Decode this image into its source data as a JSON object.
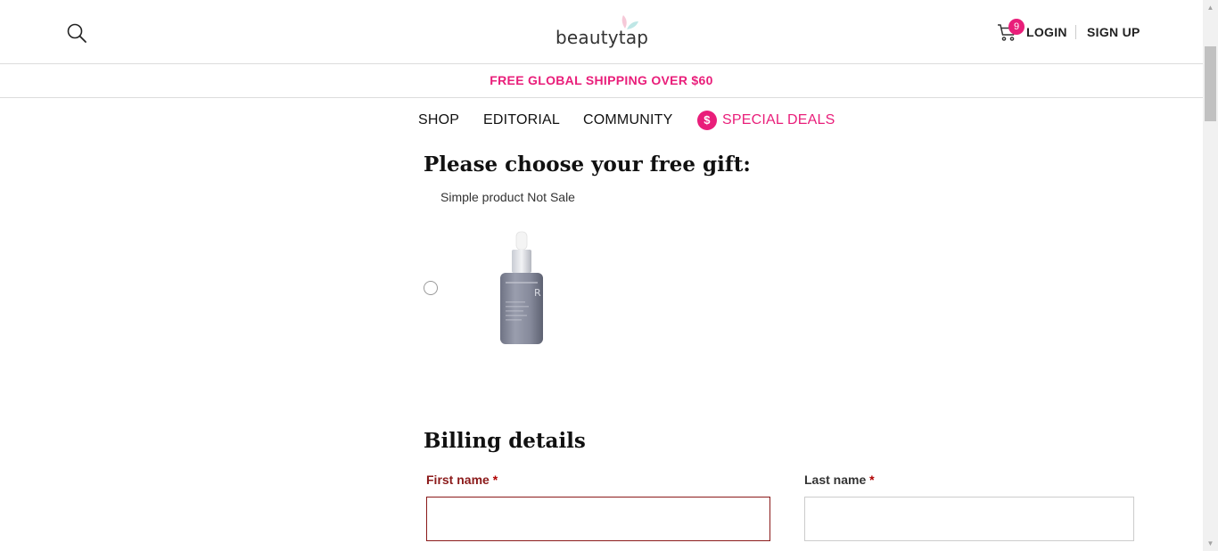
{
  "header": {
    "logo_text": "beautytap",
    "cart_count": "9",
    "login_label": "LOGIN",
    "signup_label": "SIGN UP"
  },
  "promo": {
    "text": "FREE GLOBAL SHIPPING OVER $60"
  },
  "nav": {
    "items": [
      {
        "label": "SHOP"
      },
      {
        "label": "EDITORIAL"
      },
      {
        "label": "COMMUNITY"
      },
      {
        "label": "SPECIAL DEALS",
        "icon_text": "$"
      }
    ]
  },
  "gift": {
    "title": "Please choose your free gift:",
    "product_name": "Simple product Not Sale"
  },
  "billing": {
    "title": "Billing details",
    "first_name_label": "First name",
    "last_name_label": "Last name",
    "required_mark": "*",
    "first_name_value": "",
    "last_name_value": ""
  },
  "colors": {
    "accent": "#e91e7a",
    "error": "#8b1a1a"
  },
  "icons": {
    "search": "search-icon",
    "cart": "cart-icon",
    "deals": "dollar-icon"
  }
}
